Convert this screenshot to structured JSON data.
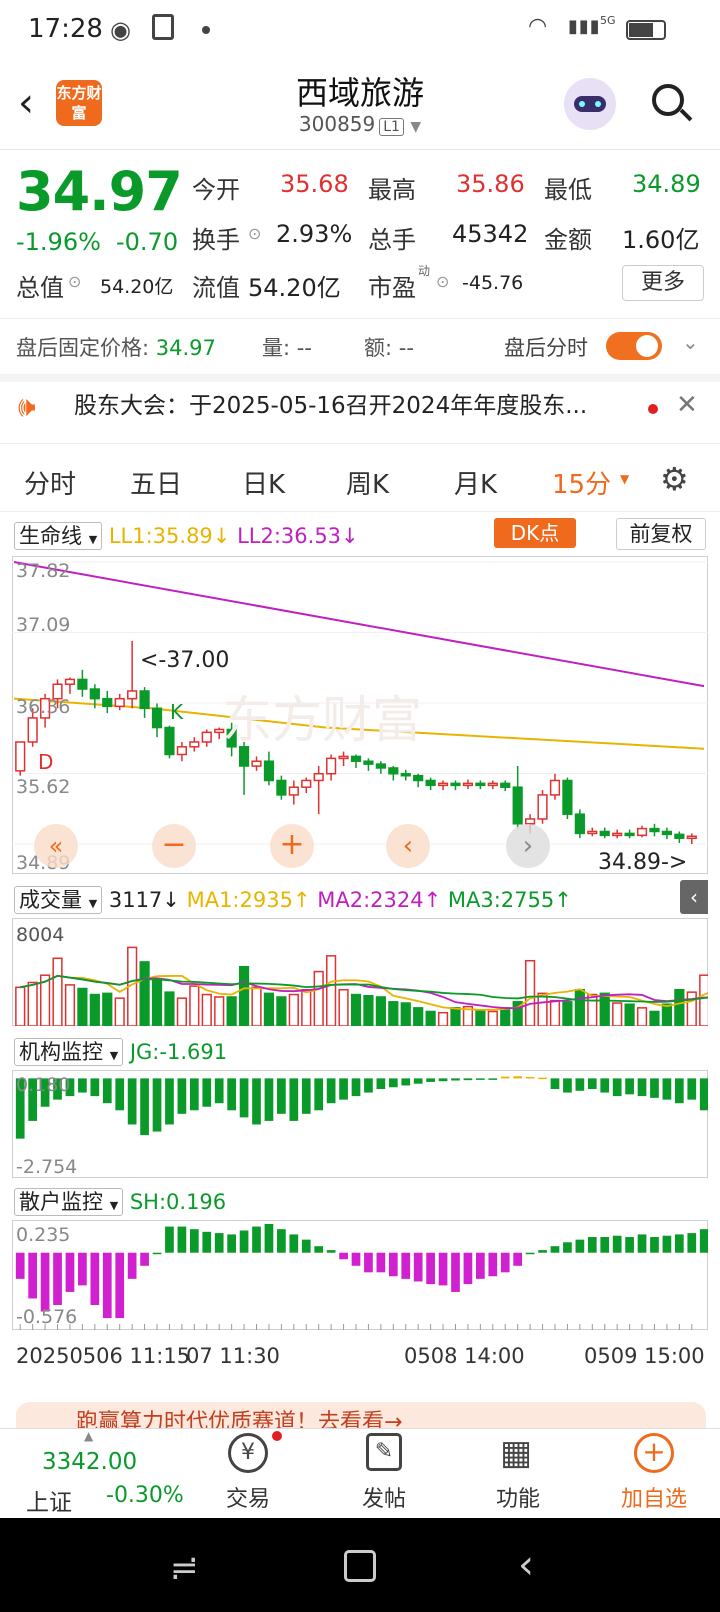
{
  "status_bar": {
    "time": "17:28",
    "signal": "5G"
  },
  "header": {
    "title": "西域旅游",
    "code": "300859",
    "level": "L1",
    "logo_text": "东方财富"
  },
  "quote": {
    "price": "34.97",
    "change_pct": "-1.96%",
    "change": "-0.70",
    "open_label": "今开",
    "open": "35.68",
    "high_label": "最高",
    "high": "35.86",
    "low_label": "最低",
    "low": "34.89",
    "turnover_label": "换手",
    "turnover": "2.93%",
    "volume_label": "总手",
    "volume": "45342",
    "amount_label": "金额",
    "amount": "1.60亿",
    "mktcap_label": "总值",
    "mktcap": "54.20亿",
    "float_label": "流值",
    "float_cap": "54.20亿",
    "pe_label": "市盈",
    "pe_sup": "动",
    "pe": "-45.76",
    "more_label": "更多"
  },
  "after_hours": {
    "price_label": "盘后固定价格:",
    "price": "34.97",
    "vol_label": "量: --",
    "amt_label": "额: --",
    "toggle_label": "盘后分时"
  },
  "notice": {
    "text": "股东大会：于2025-05-16召开2024年年度股东..."
  },
  "tabs": [
    {
      "label": "分时"
    },
    {
      "label": "五日"
    },
    {
      "label": "日K"
    },
    {
      "label": "周K"
    },
    {
      "label": "月K"
    },
    {
      "label": "15分"
    }
  ],
  "lifeline": {
    "selector": "生命线",
    "ll1": "LL1:35.89↓",
    "ll2": "LL2:36.53↓",
    "dk_label": "DK点",
    "restore_label": "前复权"
  },
  "price_axis": [
    "37.82",
    "37.09",
    "36.36",
    "35.62",
    "34.89"
  ],
  "annotations": {
    "high_mark": "<-37.00",
    "low_mark": "34.89->",
    "k_mark": "K",
    "d_mark": "D",
    "watermark": "东方财富"
  },
  "volume_panel": {
    "selector": "成交量",
    "current": "3117↓",
    "ma1": "MA1:2935↑",
    "ma2": "MA2:2324↑",
    "ma3": "MA3:2755↑",
    "axis_top": "8004"
  },
  "jg_panel": {
    "selector": "机构监控",
    "value": "JG:-1.691",
    "axis_top": "0.180",
    "axis_bottom": "-2.754"
  },
  "sh_panel": {
    "selector": "散户监控",
    "value": "SH:0.196",
    "axis_top": "0.235",
    "axis_bottom": "-0.576"
  },
  "time_axis": {
    "left": "20250506 11:15",
    "left2": "07 11:30",
    "mid": "0508 14:00",
    "right": "0509 15:00"
  },
  "ad_strip": {
    "text": "跑赢算力时代优质赛道！去看看→"
  },
  "bottom_nav": {
    "index_value": "3342.00",
    "index_name": "上证",
    "index_change": "-0.30%",
    "items": [
      {
        "label": "交易"
      },
      {
        "label": "发帖"
      },
      {
        "label": "功能"
      },
      {
        "label": "加自选"
      }
    ]
  },
  "colors": {
    "up": "#e03030",
    "down": "#0a9a2a",
    "accent": "#f06a1e",
    "ll1": "#e8b400",
    "ll2": "#c020c0"
  },
  "chart_data": {
    "type": "candlestick",
    "interval": "15分",
    "y_range": [
      34.89,
      37.82
    ],
    "candles": [
      [
        35.65,
        35.95,
        35.95,
        35.6
      ],
      [
        35.95,
        36.2,
        36.3,
        35.9
      ],
      [
        36.2,
        36.4,
        36.45,
        36.1
      ],
      [
        36.4,
        36.55,
        36.6,
        36.3
      ],
      [
        36.55,
        36.6,
        36.62,
        36.45
      ],
      [
        36.6,
        36.5,
        36.7,
        36.42
      ],
      [
        36.5,
        36.4,
        36.55,
        36.3
      ],
      [
        36.4,
        36.32,
        36.48,
        36.25
      ],
      [
        36.32,
        36.4,
        36.45,
        36.28
      ],
      [
        36.4,
        36.48,
        37.0,
        36.3
      ],
      [
        36.48,
        36.3,
        36.52,
        36.2
      ],
      [
        36.3,
        36.1,
        36.35,
        36.0
      ],
      [
        36.1,
        35.82,
        36.12,
        35.78
      ],
      [
        35.82,
        35.9,
        35.95,
        35.75
      ],
      [
        35.9,
        35.95,
        36.0,
        35.85
      ],
      [
        35.95,
        36.05,
        36.08,
        35.9
      ],
      [
        36.05,
        36.08,
        36.1,
        35.98
      ],
      [
        36.08,
        35.9,
        36.15,
        35.8
      ],
      [
        35.9,
        35.7,
        35.95,
        35.4
      ],
      [
        35.7,
        35.75,
        35.8,
        35.65
      ],
      [
        35.75,
        35.55,
        35.85,
        35.5
      ],
      [
        35.55,
        35.4,
        35.6,
        35.35
      ],
      [
        35.4,
        35.48,
        35.55,
        35.3
      ],
      [
        35.48,
        35.55,
        35.58,
        35.42
      ],
      [
        35.55,
        35.62,
        35.7,
        35.2
      ],
      [
        35.62,
        35.78,
        35.82,
        35.55
      ],
      [
        35.78,
        35.8,
        35.85,
        35.7
      ],
      [
        35.8,
        35.75,
        35.82,
        35.68
      ],
      [
        35.75,
        35.72,
        35.78,
        35.65
      ],
      [
        35.72,
        35.68,
        35.75,
        35.62
      ],
      [
        35.68,
        35.62,
        35.7,
        35.55
      ],
      [
        35.62,
        35.6,
        35.66,
        35.55
      ],
      [
        35.6,
        35.55,
        35.62,
        35.48
      ],
      [
        35.55,
        35.5,
        35.58,
        35.45
      ],
      [
        35.5,
        35.52,
        35.55,
        35.45
      ],
      [
        35.52,
        35.5,
        35.55,
        35.45
      ],
      [
        35.5,
        35.52,
        35.56,
        35.46
      ],
      [
        35.52,
        35.5,
        35.55,
        35.46
      ],
      [
        35.5,
        35.52,
        35.55,
        35.46
      ],
      [
        35.52,
        35.48,
        35.55,
        35.44
      ],
      [
        35.48,
        35.1,
        35.7,
        35.05
      ],
      [
        35.1,
        35.15,
        35.2,
        35.0
      ],
      [
        35.15,
        35.4,
        35.45,
        35.1
      ],
      [
        35.4,
        35.55,
        35.62,
        35.35
      ],
      [
        35.55,
        35.2,
        35.58,
        35.15
      ],
      [
        35.2,
        35.0,
        35.25,
        34.95
      ],
      [
        35.0,
        35.02,
        35.06,
        34.97
      ],
      [
        35.02,
        34.98,
        35.06,
        34.95
      ],
      [
        34.98,
        35.0,
        35.04,
        34.95
      ],
      [
        35.0,
        34.98,
        35.04,
        34.95
      ],
      [
        34.98,
        35.05,
        35.08,
        34.96
      ],
      [
        35.05,
        35.02,
        35.1,
        34.97
      ],
      [
        35.02,
        34.99,
        35.06,
        34.94
      ],
      [
        34.99,
        34.95,
        35.02,
        34.9
      ],
      [
        34.95,
        34.97,
        35.0,
        34.89
      ]
    ],
    "ll1": [
      36.4,
      35.88
    ],
    "ll2": [
      37.82,
      36.53
    ],
    "volume": [
      3200,
      3600,
      4200,
      5600,
      3400,
      3100,
      2600,
      2700,
      2300,
      6500,
      5300,
      3800,
      2800,
      2300,
      3300,
      2600,
      2400,
      2400,
      4900,
      3200,
      2700,
      2400,
      2600,
      3000,
      4500,
      5800,
      3000,
      2600,
      2500,
      2400,
      2000,
      1900,
      1500,
      1200,
      1100,
      1500,
      1600,
      1300,
      1200,
      1500,
      2000,
      5400,
      2700,
      2100,
      2000,
      3000,
      2600,
      2700,
      1900,
      1800,
      1500,
      1200,
      1800,
      3000,
      2800,
      4200,
      3117
    ],
    "jg": [
      -1.7,
      -1.2,
      -0.8,
      -0.6,
      -0.5,
      -0.4,
      -0.5,
      -0.7,
      -0.9,
      -1.3,
      -1.6,
      -1.5,
      -1.3,
      -1.0,
      -0.9,
      -0.8,
      -0.7,
      -0.9,
      -1.1,
      -1.3,
      -1.2,
      -1.0,
      -1.2,
      -1.0,
      -0.9,
      -0.7,
      -0.6,
      -0.5,
      -0.4,
      -0.3,
      -0.25,
      -0.2,
      -0.15,
      -0.1,
      -0.08,
      -0.06,
      -0.05,
      -0.03,
      -0.02,
      0.05,
      0.06,
      0.04,
      0.02,
      -0.3,
      -0.4,
      -0.35,
      -0.3,
      -0.4,
      -0.5,
      -0.45,
      -0.5,
      -0.55,
      -0.6,
      -0.7,
      -0.6,
      -0.9,
      -1.691
    ],
    "sh": [
      -0.2,
      -0.35,
      -0.45,
      -0.4,
      -0.3,
      -0.25,
      -0.4,
      -0.5,
      -0.5,
      -0.2,
      -0.1,
      0.0,
      0.2,
      0.2,
      0.18,
      0.16,
      0.15,
      0.14,
      0.17,
      0.2,
      0.22,
      0.18,
      0.14,
      0.1,
      0.05,
      0.02,
      -0.05,
      -0.1,
      -0.15,
      -0.15,
      -0.18,
      -0.2,
      -0.22,
      -0.24,
      -0.25,
      -0.3,
      -0.24,
      -0.2,
      -0.18,
      -0.15,
      -0.1,
      0.0,
      0.02,
      0.05,
      0.08,
      0.1,
      0.12,
      0.12,
      0.13,
      0.12,
      0.14,
      0.12,
      0.13,
      0.14,
      0.15,
      0.18,
      0.196
    ]
  }
}
